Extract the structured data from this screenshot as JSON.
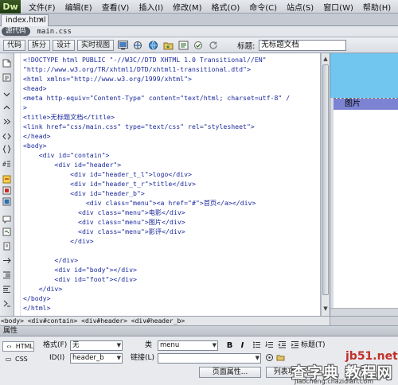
{
  "app": {
    "logo": "Dw",
    "menus": [
      "文件(F)",
      "编辑(E)",
      "查看(V)",
      "插入(I)",
      "修改(M)",
      "格式(O)",
      "命令(C)",
      "站点(S)",
      "窗口(W)",
      "帮助(H)"
    ]
  },
  "document_tab": {
    "filename": "index.html",
    "close": "×"
  },
  "related_files": {
    "source": "源代码",
    "file": "main.css"
  },
  "toolbar": {
    "code": "代码",
    "split": "拆分",
    "design": "设计",
    "live": "实时视图",
    "title_label": "标题:",
    "title_value": "无标题文档"
  },
  "code": {
    "lines": [
      "<!DOCTYPE html PUBLIC \"-//W3C//DTD XHTML 1.0 Transitional//EN\"",
      "\"http://www.w3.org/TR/xhtml1/DTD/xhtml1-transitional.dtd\">",
      "<html xmlns=\"http://www.w3.org/1999/xhtml\">",
      "<head>",
      "<meta http-equiv=\"Content-Type\" content=\"text/html; charset=utf-8\" /",
      ">",
      "<title>无标题文档</title>",
      "<link href=\"css/main.css\" type=\"text/css\" rel=\"stylesheet\">",
      "</head>",
      "<body>",
      "    <div id=\"contain\">",
      "        <div id=\"header\">",
      "            <div id=\"header_t_l\">logo</div>",
      "            <div id=\"header_t_r\">title</div>",
      "            <div id=\"header_b\">",
      "                <div class=\"menu\"><a href=\"#\">首页</a></div>",
      "              <div class=\"menu\">电影</div>",
      "              <div class=\"menu\">图片</div>",
      "              <div class=\"menu\">影评</div>",
      "            </div>",
      "",
      "        </div>",
      "        <div id=\"body\"></div>",
      "        <div id=\"foot\"></div>",
      "    </div>",
      "</body>",
      "</html>"
    ]
  },
  "design_view": {
    "menu_text": "图片"
  },
  "status_bar": {
    "path": "<body> <div#contain> <div#header> <div#header_b>"
  },
  "properties": {
    "header": "属性",
    "html_mode": "HTML",
    "css_mode": "CSS",
    "format_label": "格式(F)",
    "format_value": "无",
    "class_label": "类",
    "class_value": "menu",
    "id_label": "ID(I)",
    "id_value": "header_b",
    "link_label": "链接(L)",
    "link_value": "",
    "title_label": "标题(T)",
    "page_props_button": "页面属性...",
    "list_button": "列表项目..."
  },
  "watermark": {
    "brand": "jb51.net",
    "main": "查字典 教程网",
    "url": "jiaocheng.chazidian.com"
  }
}
